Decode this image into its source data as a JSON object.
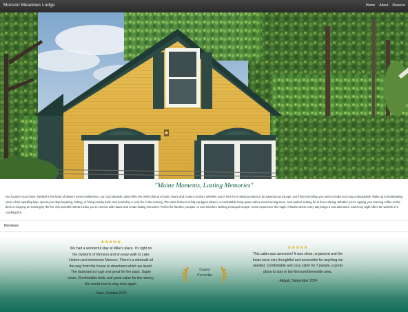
{
  "site": {
    "brand": "Monson Meadows Lodge"
  },
  "nav": {
    "items": [
      "Home",
      "About",
      "Reserve"
    ]
  },
  "hero": {
    "alt_subject": "yellow-cabin-photo"
  },
  "intro": {
    "tagline": "\"Maine Moments, Lasting Memories\"",
    "body": "Our house is your home. Nestled in the heart of Maine's serene wilderness, our cozy lakeside cabin offers the perfect blend of rustic charm and modern comfort. Whether you're here for a relaxing retreat or an adventurous escape, you'll find everything you need to make your stay unforgettable. Wake up to breathtaking views of the sparkling lake, spend your days kayaking, fishing, or hiking nearby trails, and unwind by a cozy fire in the evening. The cabin features a fully equipped kitchen, a comfortable living space with a wood-burning stove, and outdoor seating for al fresco dining. Whether you're sipping your morning coffee on the deck or enjoying an evening by the fire, this peaceful retreat invites you to connect with nature and create lasting memories. Perfect for families, couples, or solo travelers seeking a tranquil escape. Come experience the magic of Maine where every day brings a new adventure, and every night offers the warmth of a crackling fire."
  },
  "reviews": {
    "heading": "Reviews",
    "badge": {
      "line1": "Guest",
      "line2": "Favorite"
    },
    "items": [
      {
        "stars": "★★★★★",
        "text": "We had a wonderful stay at Mike's place. It's right on the outskirts of Monson and an easy walk to Lake Hebron and downtown Monson. There's a sidewalk all the way from the house to downtown which we loved. The backyard is huge and great for the pups. Super clean. Comfortable beds and great value for the money. We would love to stay here again.",
        "author": "-Sara, October 2024"
      },
      {
        "stars": "★★★★★",
        "text": "This cabin was awesome! It was clean, organized and the hosts were very thoughtful and accessible for anything we needed. Comfortable and cozy cabin for 7 people, a great place to stay in the Monson/Greenville area.",
        "author": "-Abigail, September 2024"
      }
    ]
  },
  "colors": {
    "accent": "#0d5a3f",
    "reviews_gradient_end": "#126f5a",
    "cabin_siding": "#e3b64a",
    "cabin_trim": "#2f4a44"
  }
}
